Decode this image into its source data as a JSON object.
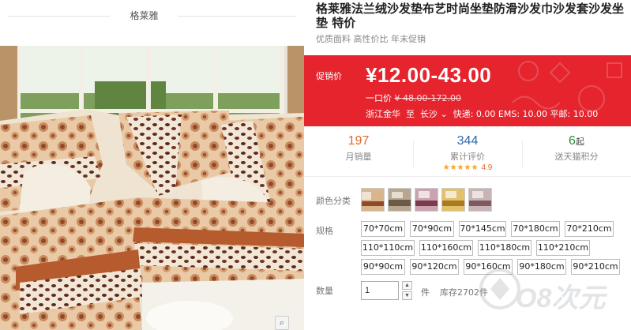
{
  "brand": {
    "name": "格莱雅"
  },
  "product": {
    "title": "格莱雅法兰绒沙发垫布艺时尚坐垫防滑沙发巾沙发套沙发坐垫 特价",
    "subtitle": "优质面料 高性价比 年末促销"
  },
  "price": {
    "promo_label": "促销价",
    "promo_price": "¥12.00-43.00",
    "original_label": "一口价",
    "original_price": "¥ 48.00-172.00",
    "ship_from": "浙江金华",
    "ship_to_label": "至",
    "ship_to": "长沙",
    "ship_fees": "快递: 0.00 EMS: 10.00 平邮: 10.00"
  },
  "stats": {
    "sales_count": "197",
    "sales_label": "月销量",
    "reviews_count": "344",
    "reviews_label": "累计评价",
    "rating_stars": "★★★★★",
    "rating_score": "4.9",
    "points_count": "6",
    "points_suffix": "起",
    "points_label": "送天猫积分"
  },
  "colors": {
    "label": "颜色分类",
    "swatch_count": 5,
    "accent": "#e5242e"
  },
  "specs": {
    "label": "规格",
    "options": [
      "70*70cm",
      "70*90cm",
      "70*145cm",
      "70*180cm",
      "70*210cm",
      "110*110cm",
      "110*160cm",
      "110*180cm",
      "110*210cm",
      "90*90cm",
      "90*120cm",
      "90*160cm",
      "90*180cm",
      "90*210cm"
    ]
  },
  "quantity": {
    "label": "数量",
    "value": "1",
    "unit": "件",
    "stock": "库存2702件"
  },
  "watermark": {
    "text": "O8次元"
  },
  "icons": {
    "zoom": "magnifier-icon"
  }
}
